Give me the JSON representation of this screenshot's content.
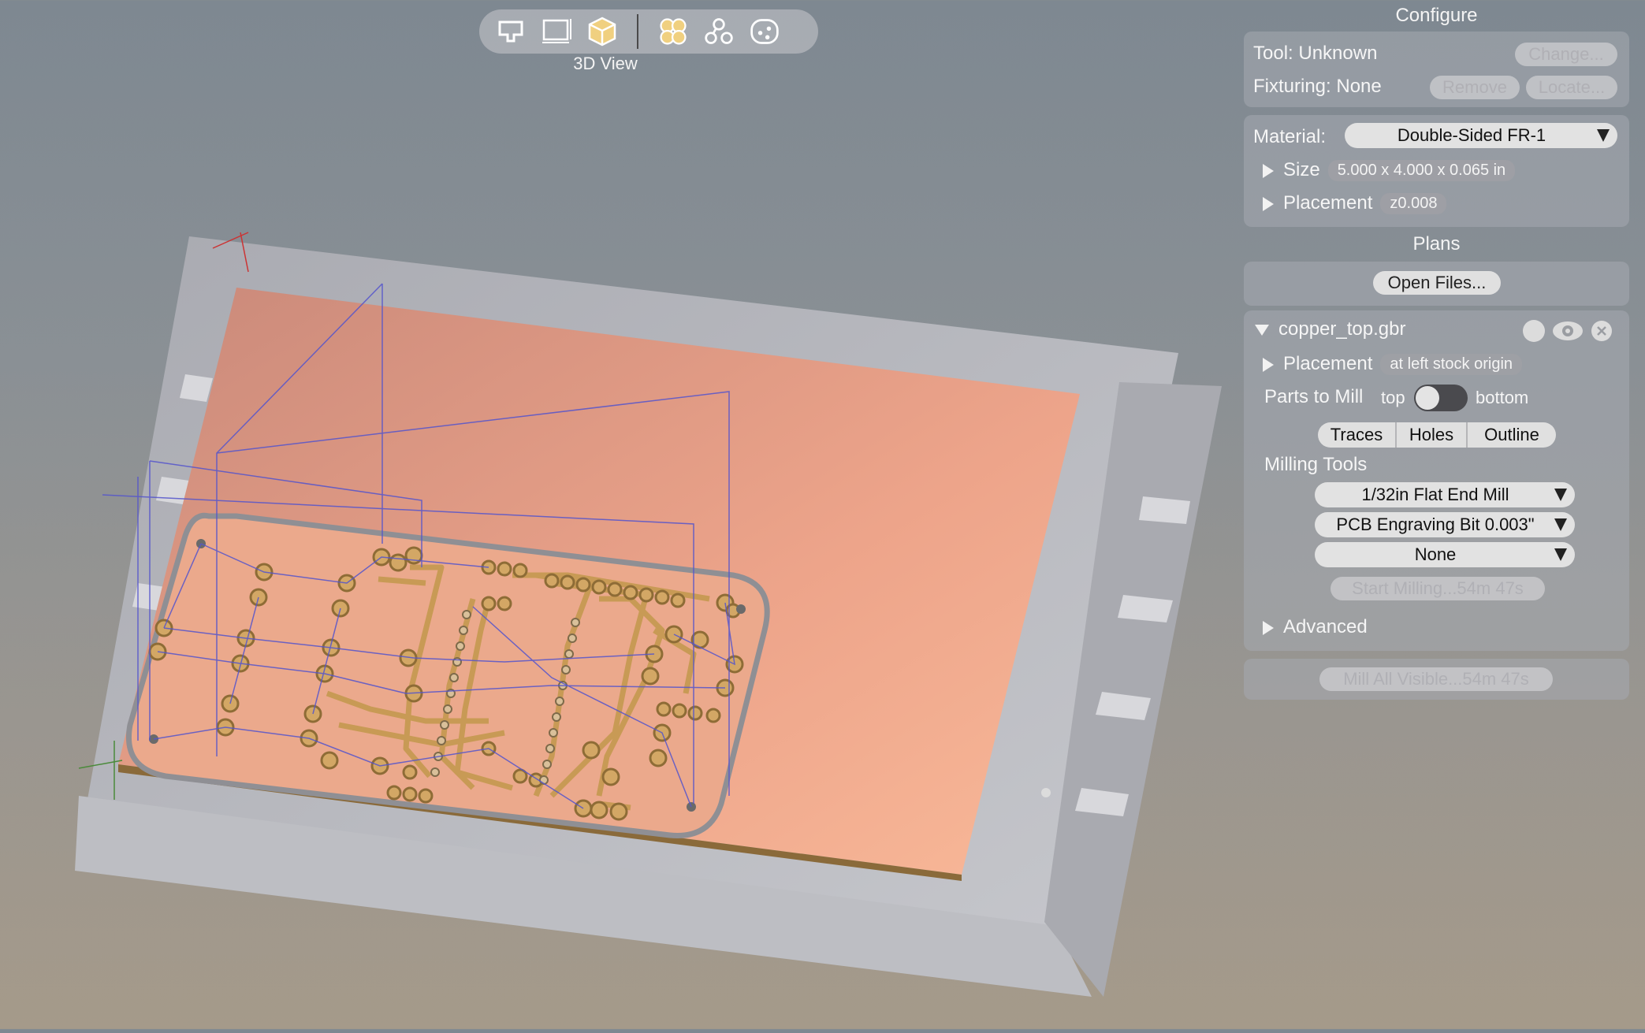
{
  "toolbar": {
    "buttons": [
      {
        "icon": "top-view-icon"
      },
      {
        "icon": "side-view-icon"
      },
      {
        "icon": "3d-view-icon",
        "active": true
      },
      {
        "icon": "show-all-layers-icon",
        "active": true
      },
      {
        "icon": "show-traces-icon"
      },
      {
        "icon": "show-holes-icon"
      }
    ],
    "view_label": "3D View"
  },
  "configure": {
    "title": "Configure",
    "tool_label": "Tool: Unknown",
    "change_button": "Change...",
    "fixturing_label": "Fixturing: None",
    "remove_button": "Remove",
    "locate_button": "Locate...",
    "material_label": "Material:",
    "material_value": "Double-Sided FR-1",
    "size_label": "Size",
    "size_value": "5.000 x 4.000 x 0.065 in",
    "placement_label": "Placement",
    "placement_value": "z0.008"
  },
  "plans": {
    "title": "Plans",
    "open_files_button": "Open Files...",
    "file": {
      "name": "copper_top.gbr",
      "placement_label": "Placement",
      "placement_value": "at left stock origin",
      "parts_to_mill_label": "Parts to Mill",
      "toggle_left": "top",
      "toggle_right": "bottom",
      "segments": [
        "Traces",
        "Holes",
        "Outline"
      ],
      "milling_tools_label": "Milling Tools",
      "tools": [
        "1/32in Flat End Mill",
        "PCB Engraving Bit 0.003\"",
        "None"
      ],
      "start_milling_button": "Start Milling...54m 47s",
      "advanced_label": "Advanced"
    },
    "mill_all_button": "Mill All Visible...54m 47s"
  },
  "colors": {
    "copper": "#e8a082",
    "fixture": "#c8c9ce",
    "trace": "#c8a060",
    "toolpath": "#5a5ad0"
  }
}
